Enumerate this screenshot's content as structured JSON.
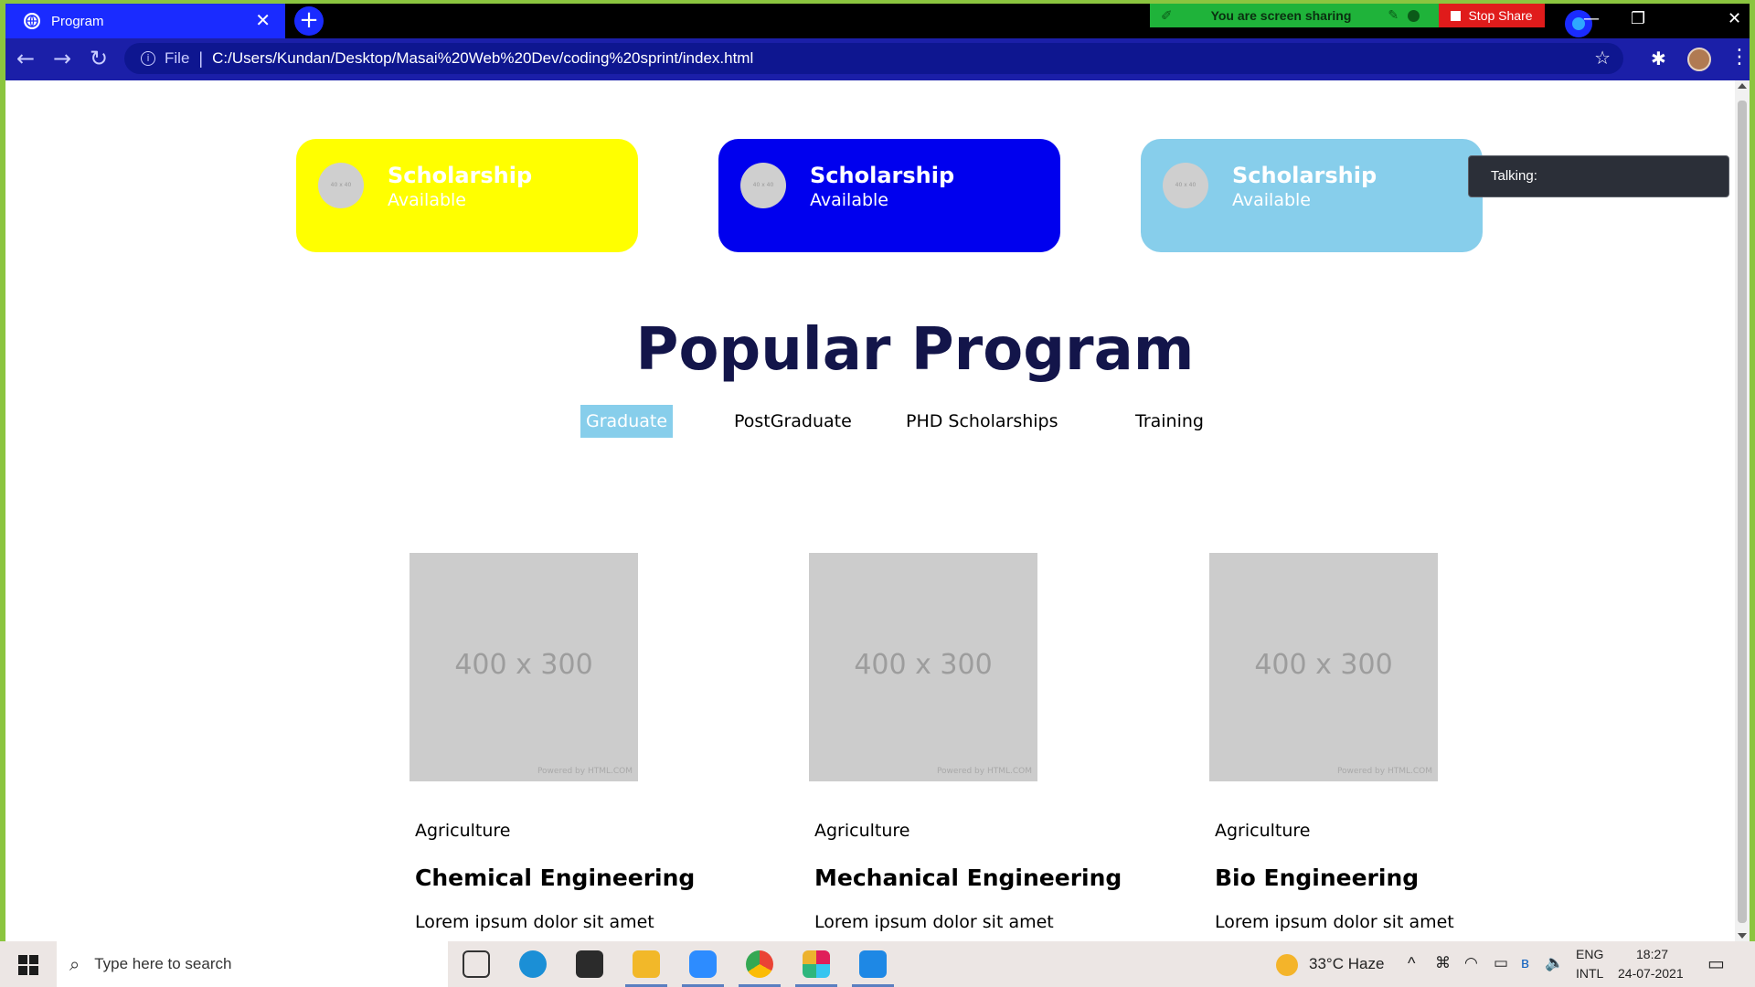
{
  "browser": {
    "tab_title": "Program",
    "tab_close": "✕",
    "new_tab": "+",
    "sharing_text": "You are screen sharing",
    "stop_share": "Stop Share",
    "file_label": "File",
    "separator": "|",
    "url": "C:/Users/Kundan/Desktop/Masai%20Web%20Dev/coding%20sprint/index.html",
    "back": "←",
    "forward": "→",
    "reload": "↻",
    "minimize": "—",
    "restore": "❐",
    "close": "✕",
    "bookmark": "☆",
    "extensions": "✱",
    "menu": "⋮"
  },
  "talking_popup": "Talking:",
  "cards": [
    {
      "title": "Scholarship",
      "subtitle": "Available",
      "color": "#ffff00",
      "image_text": "40 x 40"
    },
    {
      "title": "Scholarship",
      "subtitle": "Available",
      "color": "#0000ee",
      "image_text": "40 x 40"
    },
    {
      "title": "Scholarship",
      "subtitle": "Available",
      "color": "#87ceeb",
      "image_text": "40 x 40"
    }
  ],
  "heading": "Popular Program",
  "program_tabs": [
    {
      "label": "Graduate",
      "active": true
    },
    {
      "label": "PostGraduate",
      "active": false
    },
    {
      "label": "PHD Scholarships",
      "active": false
    },
    {
      "label": "Training",
      "active": false
    }
  ],
  "programs": [
    {
      "image_text": "400 x 300",
      "image_credit": "Powered by HTML.COM",
      "category": "Agriculture",
      "title": "Chemical Engineering",
      "description": "Lorem ipsum dolor sit amet"
    },
    {
      "image_text": "400 x 300",
      "image_credit": "Powered by HTML.COM",
      "category": "Agriculture",
      "title": "Mechanical Engineering",
      "description": "Lorem ipsum dolor sit amet"
    },
    {
      "image_text": "400 x 300",
      "image_credit": "Powered by HTML.COM",
      "category": "Agriculture",
      "title": "Bio Engineering",
      "description": "Lorem ipsum dolor sit amet"
    }
  ],
  "taskbar": {
    "search_placeholder": "Type here to search",
    "search_icon": "⌕",
    "weather": "33°C  Haze",
    "language_top": "ENG",
    "language_bottom": "INTL",
    "time": "18:27",
    "date": "24-07-2021",
    "tray_caret": "^"
  },
  "colors": {
    "heading": "#13154a",
    "active_tab": "#87ceeb",
    "placeholder": "#cccccc",
    "toolbar": "#1b1fa8",
    "tab": "#1a2bff"
  }
}
